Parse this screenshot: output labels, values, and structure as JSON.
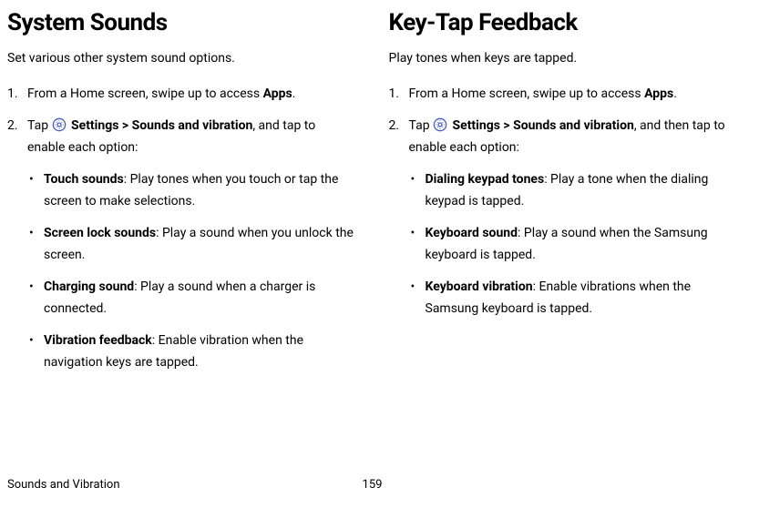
{
  "left": {
    "heading": "System Sounds",
    "intro": "Set various other system sound options.",
    "step1_prefix": "From a Home screen, swipe up to access ",
    "step1_bold": "Apps",
    "step1_suffix": ".",
    "step2_prefix": "Tap ",
    "step2_settings": "Settings",
    "step2_gt": " > ",
    "step2_path": "Sounds and vibration",
    "step2_suffix": ", and tap to enable each option:",
    "bullets": [
      {
        "title": "Touch sounds",
        "desc": ": Play tones when you touch or tap the screen to make selections."
      },
      {
        "title": "Screen lock sounds",
        "desc": ": Play a sound when you unlock the screen."
      },
      {
        "title": "Charging sound",
        "desc": ": Play a sound when a charger is connected."
      },
      {
        "title": "Vibration feedback",
        "desc": ": Enable vibration when the navigation keys are tapped."
      }
    ]
  },
  "right": {
    "heading": "Key-Tap Feedback",
    "intro": "Play tones when keys are tapped.",
    "step1_prefix": "From a Home screen, swipe up to access ",
    "step1_bold": "Apps",
    "step1_suffix": ".",
    "step2_prefix": "Tap ",
    "step2_settings": "Settings",
    "step2_gt": " > ",
    "step2_path": "Sounds and vibration",
    "step2_suffix": ", and then tap to enable each option:",
    "bullets": [
      {
        "title": "Dialing keypad tones",
        "desc": ": Play a tone when the dialing keypad is tapped."
      },
      {
        "title": "Keyboard sound",
        "desc": ": Play a sound when the Samsung keyboard is tapped."
      },
      {
        "title": "Keyboard vibration",
        "desc": ": Enable vibrations when the Samsung keyboard is tapped."
      }
    ]
  },
  "footer": {
    "section": "Sounds and Vibration",
    "page": "159"
  },
  "icons": {
    "settings": "settings-icon"
  }
}
